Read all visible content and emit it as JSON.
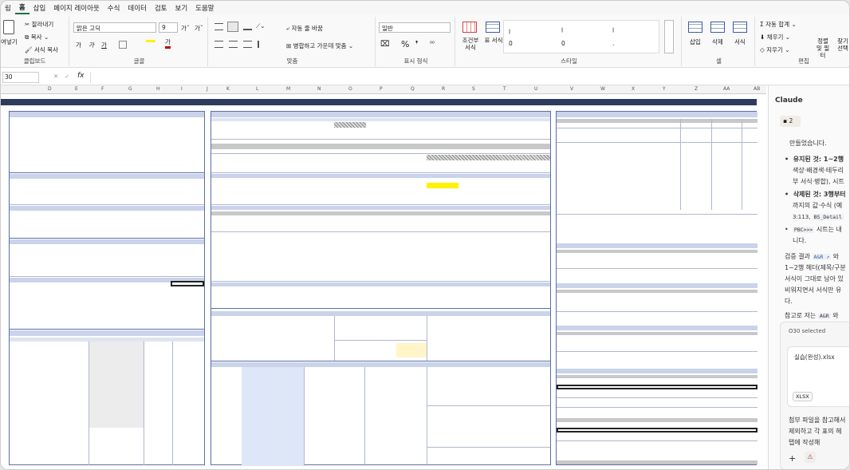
{
  "menu": [
    "림",
    "홈",
    "삽입",
    "페이지 레이아웃",
    "수식",
    "데이터",
    "검토",
    "보기",
    "도움말"
  ],
  "ribbon": {
    "clipboard": {
      "paste": "여넣기",
      "cut": "잘라내기",
      "copy": "복사",
      "format_painter": "서식 복사",
      "label": "클립보드"
    },
    "font": {
      "name": "맑은 고딕",
      "size": "9",
      "grow": "가ˆ",
      "shrink": "가ˇ",
      "bold": "가",
      "italic": "가",
      "underline": "가",
      "label": "글꼴"
    },
    "align": {
      "wrap": "자동 줄 바꿈",
      "merge": "병합하고 가운데 맞춤",
      "label": "맞춤"
    },
    "number": {
      "format": "일반",
      "label": "표시 형식"
    },
    "styles": {
      "cond": "조건부 서식",
      "table": "표 서식",
      "label": "스타일",
      "cells": [
        "ꞁ",
        "ꞁ",
        "ꞁ",
        "0",
        "0",
        "."
      ]
    },
    "cells": {
      "insert": "삽입",
      "delete": "삭제",
      "format": "서식",
      "label": "셀"
    },
    "edit": {
      "autosum": "자동 합계",
      "fill": "채우기",
      "clear": "지우기",
      "sort": "정렬 및 필터",
      "find": "찾기 선택",
      "label": "편집"
    }
  },
  "formula": {
    "namebox": "30",
    "fx": "fx"
  },
  "columns": [
    "D",
    "E",
    "F",
    "G",
    "H",
    "I",
    "J",
    "K",
    "L",
    "M",
    "N",
    "O",
    "P",
    "Q",
    "R",
    "S",
    "T",
    "U",
    "V",
    "W",
    "X",
    "Y",
    "Z",
    "AA",
    "AB",
    "A"
  ],
  "panel": {
    "title": "Claude",
    "badge": "2",
    "lines": [
      "만들었습니다.",
      "유지된 것: 1~2행",
      "색상·배경색·테두리",
      "부 서식·병합), 시트",
      "삭제된 것: 3행부터",
      "까지의 값·수식 (예",
      "3:113,",
      "시트는 내",
      "니다.",
      "검증 결과",
      "와",
      "1~2행 헤더(제목/구분",
      "서식이 그대로 남아 있",
      "비워지면서 서식만 유",
      "다.",
      "참고로 저는",
      "와"
    ],
    "codes": [
      "BS_Detail",
      "PBC>>>",
      "A&R ↗",
      "A&R"
    ],
    "selected": "O30 selected",
    "file_name": "실습(완성).xlsx",
    "file_type": "XLSX",
    "prompt": [
      "첨부 파일을 참고해서",
      "제외하고 각 표의 헤",
      "탭에 작성해"
    ],
    "plus": "+",
    "warn": "⚠"
  },
  "colors": {
    "accent": "#1a7343",
    "navy": "#2e3b5c",
    "header": "#c9d3ea",
    "yellow": "#fff200"
  }
}
